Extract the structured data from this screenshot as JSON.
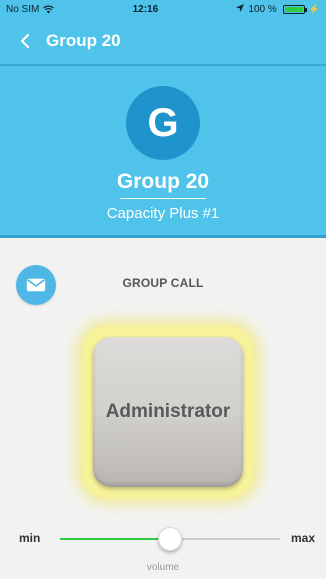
{
  "status_bar": {
    "carrier": "No SIM",
    "time": "12:16",
    "battery": "100 %",
    "battery_level": 1.0
  },
  "nav": {
    "back_icon": "chevron-left-icon",
    "title": "Group 20"
  },
  "header": {
    "avatar_letter": "G",
    "group_name": "Group 20",
    "subtitle": "Capacity Plus #1"
  },
  "content": {
    "mail_icon": "envelope-icon",
    "call_type": "GROUP CALL",
    "ptt_label": "Administrator"
  },
  "volume": {
    "min_label": "min",
    "max_label": "max",
    "label": "volume",
    "level": 0.5
  },
  "colors": {
    "primary": "#4fc3ea",
    "avatar": "#1f94cc",
    "slider_fill": "#2ecc40",
    "ptt_glow": "#f6f39a"
  }
}
